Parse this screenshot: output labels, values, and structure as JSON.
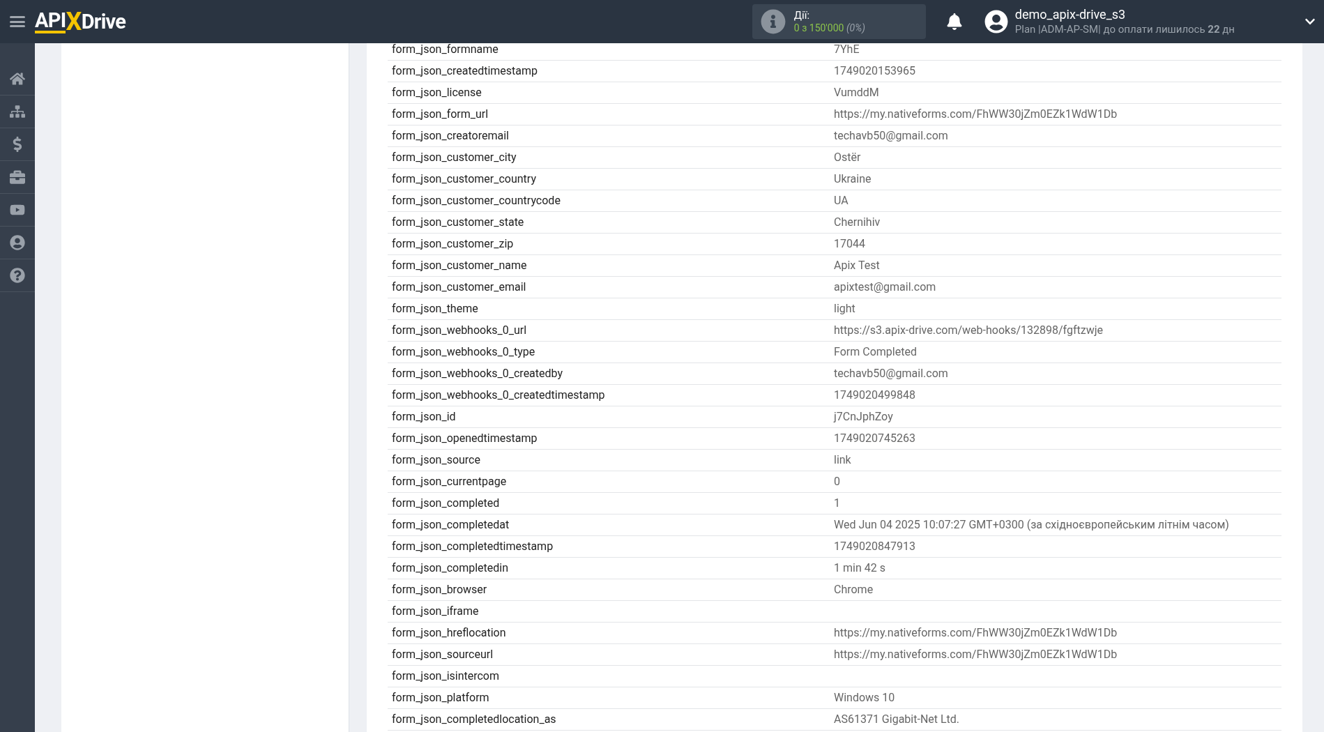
{
  "header": {
    "logo": {
      "left": "API",
      "middle": "X",
      "right": "Drive"
    },
    "actions": {
      "label": "Дії:",
      "count": "0 з 150'000",
      "percent": "(0%)"
    },
    "user": {
      "name": "demo_apix-drive_s3",
      "plan": "Plan |ADM-AP-SM| до оплати лишилось **22** дн"
    }
  },
  "sidebar": {
    "items": [
      {
        "kind": "home",
        "selected": false
      },
      {
        "kind": "sitemap",
        "selected": false
      },
      {
        "kind": "dollar",
        "selected": false
      },
      {
        "kind": "briefcase",
        "selected": false
      },
      {
        "kind": "video",
        "selected": false
      },
      {
        "kind": "user",
        "selected": false
      },
      {
        "kind": "help",
        "selected": false
      }
    ]
  },
  "table": {
    "rows": [
      {
        "key": "form_json_formname",
        "value": "7YhE"
      },
      {
        "key": "form_json_createdtimestamp",
        "value": "1749020153965"
      },
      {
        "key": "form_json_license",
        "value": "VumddM"
      },
      {
        "key": "form_json_form_url",
        "value": "https://my.nativeforms.com/FhWW30jZm0EZk1WdW1Db"
      },
      {
        "key": "form_json_creatoremail",
        "value": "techavb50@gmail.com"
      },
      {
        "key": "form_json_customer_city",
        "value": "Ostër"
      },
      {
        "key": "form_json_customer_country",
        "value": "Ukraine"
      },
      {
        "key": "form_json_customer_countrycode",
        "value": "UA"
      },
      {
        "key": "form_json_customer_state",
        "value": "Chernihiv"
      },
      {
        "key": "form_json_customer_zip",
        "value": "17044"
      },
      {
        "key": "form_json_customer_name",
        "value": "Apix Test"
      },
      {
        "key": "form_json_customer_email",
        "value": "apixtest@gmail.com"
      },
      {
        "key": "form_json_theme",
        "value": "light"
      },
      {
        "key": "form_json_webhooks_0_url",
        "value": "https://s3.apix-drive.com/web-hooks/132898/fgftzwje"
      },
      {
        "key": "form_json_webhooks_0_type",
        "value": "Form Completed"
      },
      {
        "key": "form_json_webhooks_0_createdby",
        "value": "techavb50@gmail.com"
      },
      {
        "key": "form_json_webhooks_0_createdtimestamp",
        "value": "1749020499848"
      },
      {
        "key": "form_json_id",
        "value": "j7CnJphZoy"
      },
      {
        "key": "form_json_openedtimestamp",
        "value": "1749020745263"
      },
      {
        "key": "form_json_source",
        "value": "link"
      },
      {
        "key": "form_json_currentpage",
        "value": "0"
      },
      {
        "key": "form_json_completed",
        "value": "1"
      },
      {
        "key": "form_json_completedat",
        "value": "Wed Jun 04 2025 10:07:27 GMT+0300 (за східноєвропейським літнім часом)"
      },
      {
        "key": "form_json_completedtimestamp",
        "value": "1749020847913"
      },
      {
        "key": "form_json_completedin",
        "value": "1 min 42 s"
      },
      {
        "key": "form_json_browser",
        "value": "Chrome"
      },
      {
        "key": "form_json_iframe"
      },
      {
        "key": "form_json_hreflocation",
        "value": "https://my.nativeforms.com/FhWW30jZm0EZk1WdW1Db"
      },
      {
        "key": "form_json_sourceurl",
        "value": "https://my.nativeforms.com/FhWW30jZm0EZk1WdW1Db"
      },
      {
        "key": "form_json_isintercom"
      },
      {
        "key": "form_json_platform",
        "value": "Windows 10"
      },
      {
        "key": "form_json_completedlocation_as",
        "value": "AS61371 Gigabit-Net Ltd."
      }
    ]
  }
}
